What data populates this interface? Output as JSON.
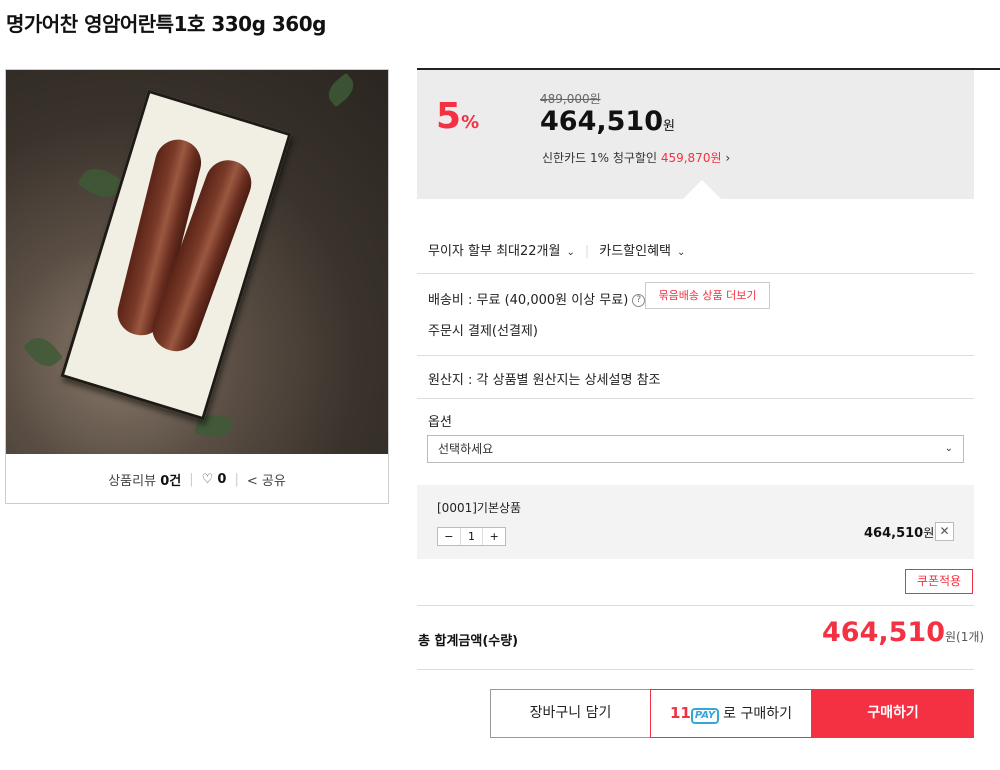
{
  "product": {
    "title": "명가어찬 영암어란특1호 330g 360g"
  },
  "image_footer": {
    "review_label": "상품리뷰",
    "review_count": "0건",
    "likes": "0",
    "share_label": "공유"
  },
  "price": {
    "discount_number": "5",
    "discount_unit": "%",
    "original": "489,000원",
    "sale": "464,510",
    "won": "원",
    "card_discount_text": "신한카드 1% 청구할인",
    "card_discount_price": "459,870원",
    "card_discount_arrow": "›"
  },
  "installment": {
    "label": "무이자 할부 최대22개월",
    "card_benefit": "카드할인혜택"
  },
  "shipping": {
    "fee": "배송비 : 무료 (40,000원 이상 무료)",
    "bundle_button": "묶음배송 상품 더보기",
    "payment": "주문시 결제(선결제)"
  },
  "origin": {
    "text": "원산지 : 각 상품별 원산지는 상세설명 참조"
  },
  "option": {
    "label": "옵션",
    "placeholder": "선택하세요"
  },
  "selected_option": {
    "name": "[0001]기본상품",
    "minus": "−",
    "quantity": "1",
    "plus": "+",
    "price": "464,510",
    "won": "원",
    "delete": "✕"
  },
  "coupon_button": "쿠폰적용",
  "total": {
    "label": "총 합계금액(수량)",
    "price": "464,510",
    "suffix": "원(1개)"
  },
  "buttons": {
    "cart": "장바구니 담기",
    "pay_11": "11",
    "pay_logo": "PAY",
    "pay_suffix": "로 구매하기",
    "buy": "구매하기"
  },
  "colors": {
    "accent_red": "#f43142",
    "pay_blue": "#35a7d9",
    "price_box_bg": "#ececec"
  }
}
